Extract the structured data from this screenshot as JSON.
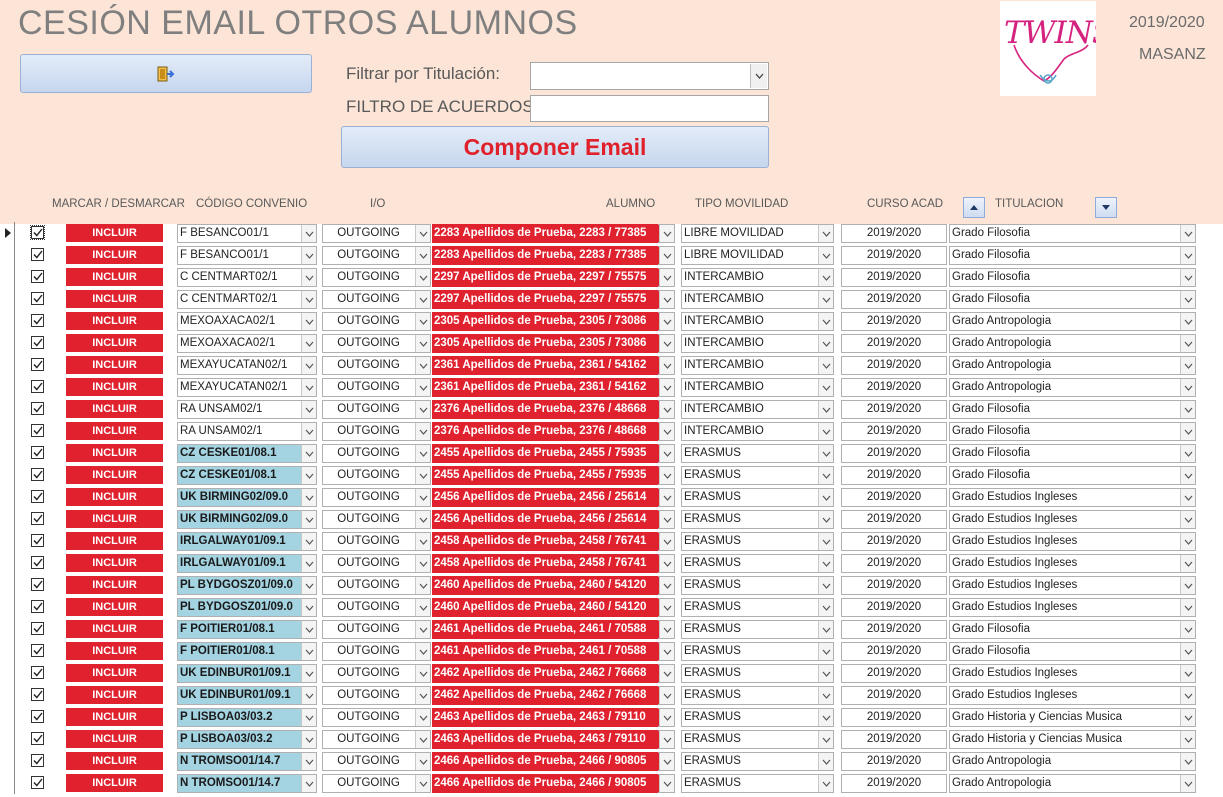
{
  "title": "CESIÓN EMAIL OTROS ALUMNOS",
  "header": {
    "exit_icon": "exit-door-icon",
    "filter_titulacion_label": "Filtrar por Titulación:",
    "filter_titulacion_value": "",
    "filtro_acuerdos_label": "FILTRO DE ACUERDOS",
    "filtro_acuerdos_value": "",
    "compose_label": "Componer Email",
    "logo_text": "TWINS",
    "year": "2019/2020",
    "user": "MASANZ"
  },
  "columns": {
    "marcar": "MARCAR / DESMARCAR",
    "codigo": "CÓDIGO CONVENIO",
    "io": "I/O",
    "alumno": "ALUMNO",
    "tipo": "TIPO MOVILIDAD",
    "curso": "CURSO ACAD",
    "titulacion": "TITULACION"
  },
  "colors": {
    "accent_red": "#e0212e",
    "header_bg": "#fce4d6",
    "code_blue": "#a4d3e1"
  },
  "rows": [
    {
      "checked": true,
      "incluir": "INCLUIR",
      "codigo": "F BESANCO01/1",
      "codigo_style": "plain",
      "io": "OUTGOING",
      "alumno": "2283  Apellidos de Prueba, 2283 / 77385",
      "tipo": "LIBRE MOVILIDAD",
      "curso": "2019/2020",
      "titulacion": "Grado Filosofia"
    },
    {
      "checked": true,
      "incluir": "INCLUIR",
      "codigo": "F BESANCO01/1",
      "codigo_style": "plain",
      "io": "OUTGOING",
      "alumno": "2283  Apellidos de Prueba, 2283 / 77385",
      "tipo": "LIBRE MOVILIDAD",
      "curso": "2019/2020",
      "titulacion": "Grado Filosofia"
    },
    {
      "checked": true,
      "incluir": "INCLUIR",
      "codigo": "C CENTMART02/1",
      "codigo_style": "plain",
      "io": "OUTGOING",
      "alumno": "2297  Apellidos de Prueba, 2297 / 75575",
      "tipo": "INTERCAMBIO",
      "curso": "2019/2020",
      "titulacion": "Grado Filosofia"
    },
    {
      "checked": true,
      "incluir": "INCLUIR",
      "codigo": "C CENTMART02/1",
      "codigo_style": "plain",
      "io": "OUTGOING",
      "alumno": "2297  Apellidos de Prueba, 2297 / 75575",
      "tipo": "INTERCAMBIO",
      "curso": "2019/2020",
      "titulacion": "Grado Filosofia"
    },
    {
      "checked": true,
      "incluir": "INCLUIR",
      "codigo": "MEXOAXACA02/1",
      "codigo_style": "plain",
      "io": "OUTGOING",
      "alumno": "2305  Apellidos de Prueba, 2305 / 73086",
      "tipo": "INTERCAMBIO",
      "curso": "2019/2020",
      "titulacion": "Grado Antropologia"
    },
    {
      "checked": true,
      "incluir": "INCLUIR",
      "codigo": "MEXOAXACA02/1",
      "codigo_style": "plain",
      "io": "OUTGOING",
      "alumno": "2305  Apellidos de Prueba, 2305 / 73086",
      "tipo": "INTERCAMBIO",
      "curso": "2019/2020",
      "titulacion": "Grado Antropologia"
    },
    {
      "checked": true,
      "incluir": "INCLUIR",
      "codigo": "MEXAYUCATAN02/1",
      "codigo_style": "plain",
      "io": "OUTGOING",
      "alumno": "2361  Apellidos de Prueba, 2361 / 54162",
      "tipo": "INTERCAMBIO",
      "curso": "2019/2020",
      "titulacion": "Grado Antropologia"
    },
    {
      "checked": true,
      "incluir": "INCLUIR",
      "codigo": "MEXAYUCATAN02/1",
      "codigo_style": "plain",
      "io": "OUTGOING",
      "alumno": "2361  Apellidos de Prueba, 2361 / 54162",
      "tipo": "INTERCAMBIO",
      "curso": "2019/2020",
      "titulacion": "Grado Antropologia"
    },
    {
      "checked": true,
      "incluir": "INCLUIR",
      "codigo": "RA UNSAM02/1",
      "codigo_style": "plain",
      "io": "OUTGOING",
      "alumno": "2376  Apellidos de Prueba, 2376 / 48668",
      "tipo": "INTERCAMBIO",
      "curso": "2019/2020",
      "titulacion": "Grado Filosofia"
    },
    {
      "checked": true,
      "incluir": "INCLUIR",
      "codigo": "RA UNSAM02/1",
      "codigo_style": "plain",
      "io": "OUTGOING",
      "alumno": "2376  Apellidos de Prueba, 2376 / 48668",
      "tipo": "INTERCAMBIO",
      "curso": "2019/2020",
      "titulacion": "Grado Filosofia"
    },
    {
      "checked": true,
      "incluir": "INCLUIR",
      "codigo": "CZ CESKE01/08.1",
      "codigo_style": "blue",
      "io": "OUTGOING",
      "alumno": "2455  Apellidos de Prueba, 2455 / 75935",
      "tipo": "ERASMUS",
      "curso": "2019/2020",
      "titulacion": "Grado Filosofia"
    },
    {
      "checked": true,
      "incluir": "INCLUIR",
      "codigo": "CZ CESKE01/08.1",
      "codigo_style": "blue",
      "io": "OUTGOING",
      "alumno": "2455  Apellidos de Prueba, 2455 / 75935",
      "tipo": "ERASMUS",
      "curso": "2019/2020",
      "titulacion": "Grado Filosofia"
    },
    {
      "checked": true,
      "incluir": "INCLUIR",
      "codigo": "UK BIRMING02/09.0",
      "codigo_style": "blue",
      "io": "OUTGOING",
      "alumno": "2456  Apellidos de Prueba, 2456 / 25614",
      "tipo": "ERASMUS",
      "curso": "2019/2020",
      "titulacion": "Grado Estudios Ingleses"
    },
    {
      "checked": true,
      "incluir": "INCLUIR",
      "codigo": "UK BIRMING02/09.0",
      "codigo_style": "blue",
      "io": "OUTGOING",
      "alumno": "2456  Apellidos de Prueba, 2456 / 25614",
      "tipo": "ERASMUS",
      "curso": "2019/2020",
      "titulacion": "Grado Estudios Ingleses"
    },
    {
      "checked": true,
      "incluir": "INCLUIR",
      "codigo": "IRLGALWAY01/09.1",
      "codigo_style": "blue",
      "io": "OUTGOING",
      "alumno": "2458  Apellidos de Prueba, 2458 / 76741",
      "tipo": "ERASMUS",
      "curso": "2019/2020",
      "titulacion": "Grado Estudios Ingleses"
    },
    {
      "checked": true,
      "incluir": "INCLUIR",
      "codigo": "IRLGALWAY01/09.1",
      "codigo_style": "blue",
      "io": "OUTGOING",
      "alumno": "2458  Apellidos de Prueba, 2458 / 76741",
      "tipo": "ERASMUS",
      "curso": "2019/2020",
      "titulacion": "Grado Estudios Ingleses"
    },
    {
      "checked": true,
      "incluir": "INCLUIR",
      "codigo": "PL BYDGOSZ01/09.0",
      "codigo_style": "blue",
      "io": "OUTGOING",
      "alumno": "2460  Apellidos de Prueba, 2460 / 54120",
      "tipo": "ERASMUS",
      "curso": "2019/2020",
      "titulacion": "Grado Estudios Ingleses"
    },
    {
      "checked": true,
      "incluir": "INCLUIR",
      "codigo": "PL BYDGOSZ01/09.0",
      "codigo_style": "blue",
      "io": "OUTGOING",
      "alumno": "2460  Apellidos de Prueba, 2460 / 54120",
      "tipo": "ERASMUS",
      "curso": "2019/2020",
      "titulacion": "Grado Estudios Ingleses"
    },
    {
      "checked": true,
      "incluir": "INCLUIR",
      "codigo": "F POITIER01/08.1",
      "codigo_style": "blue",
      "io": "OUTGOING",
      "alumno": "2461  Apellidos de Prueba, 2461 / 70588",
      "tipo": "ERASMUS",
      "curso": "2019/2020",
      "titulacion": "Grado Filosofia"
    },
    {
      "checked": true,
      "incluir": "INCLUIR",
      "codigo": "F POITIER01/08.1",
      "codigo_style": "blue",
      "io": "OUTGOING",
      "alumno": "2461  Apellidos de Prueba, 2461 / 70588",
      "tipo": "ERASMUS",
      "curso": "2019/2020",
      "titulacion": "Grado Filosofia"
    },
    {
      "checked": true,
      "incluir": "INCLUIR",
      "codigo": "UK EDINBUR01/09.1",
      "codigo_style": "blue",
      "io": "OUTGOING",
      "alumno": "2462  Apellidos de Prueba, 2462 / 76668",
      "tipo": "ERASMUS",
      "curso": "2019/2020",
      "titulacion": "Grado Estudios Ingleses"
    },
    {
      "checked": true,
      "incluir": "INCLUIR",
      "codigo": "UK EDINBUR01/09.1",
      "codigo_style": "blue",
      "io": "OUTGOING",
      "alumno": "2462  Apellidos de Prueba, 2462 / 76668",
      "tipo": "ERASMUS",
      "curso": "2019/2020",
      "titulacion": "Grado Estudios Ingleses"
    },
    {
      "checked": true,
      "incluir": "INCLUIR",
      "codigo": "P LISBOA03/03.2",
      "codigo_style": "blue",
      "io": "OUTGOING",
      "alumno": "2463  Apellidos de Prueba, 2463 / 79110",
      "tipo": "ERASMUS",
      "curso": "2019/2020",
      "titulacion": "Grado Historia y Ciencias Musica"
    },
    {
      "checked": true,
      "incluir": "INCLUIR",
      "codigo": "P LISBOA03/03.2",
      "codigo_style": "blue",
      "io": "OUTGOING",
      "alumno": "2463  Apellidos de Prueba, 2463 / 79110",
      "tipo": "ERASMUS",
      "curso": "2019/2020",
      "titulacion": "Grado Historia y Ciencias Musica"
    },
    {
      "checked": true,
      "incluir": "INCLUIR",
      "codigo": "N TROMSO01/14.7",
      "codigo_style": "blue",
      "io": "OUTGOING",
      "alumno": "2466  Apellidos de Prueba, 2466 / 90805",
      "tipo": "ERASMUS",
      "curso": "2019/2020",
      "titulacion": "Grado Antropologia"
    },
    {
      "checked": true,
      "incluir": "INCLUIR",
      "codigo": "N TROMSO01/14.7",
      "codigo_style": "blue",
      "io": "OUTGOING",
      "alumno": "2466  Apellidos de Prueba, 2466 / 90805",
      "tipo": "ERASMUS",
      "curso": "2019/2020",
      "titulacion": "Grado Antropologia"
    }
  ]
}
